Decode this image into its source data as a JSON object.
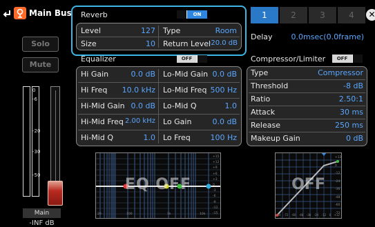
{
  "header": {
    "title": "Main Bus"
  },
  "left": {
    "solo_label": "Solo",
    "mute_label": "Mute",
    "meter_ticks": [
      "0",
      "-6",
      "-20",
      "-30",
      "-50"
    ],
    "channel_label": "Main",
    "level_readout": "-INF dB"
  },
  "reverb": {
    "title": "Reverb",
    "toggle": "ON",
    "level_label": "Level",
    "level_value": "127",
    "type_label": "Type",
    "type_value": "Room",
    "size_label": "Size",
    "size_value": "10",
    "return_label": "Return Level",
    "return_value": "-20.0 dB"
  },
  "tabs": [
    "1",
    "2",
    "3",
    "4"
  ],
  "delay": {
    "label": "Delay",
    "value": "0.0msec(0.0frame)"
  },
  "equalizer": {
    "title": "Equalizer",
    "toggle": "OFF",
    "rows": [
      {
        "l_label": "Hi Gain",
        "l_value": "0.0 dB",
        "r_label": "Lo-Mid Gain",
        "r_value": "0.0 dB"
      },
      {
        "l_label": "Hi Freq",
        "l_value": "10.0 kHz",
        "r_label": "Lo-Mid Freq",
        "r_value": "500 Hz"
      },
      {
        "l_label": "Hi-Mid Gain",
        "l_value": "0.0 dB",
        "r_label": "Lo-Mid Q",
        "r_value": "1.0"
      },
      {
        "l_label": "Hi-Mid Freq",
        "l_value": "2.00 kHz",
        "r_label": "Lo Gain",
        "r_value": "0.0 dB"
      },
      {
        "l_label": "Hi-Mid Q",
        "l_value": "1.0",
        "r_label": "Lo Freq",
        "r_value": "100 Hz"
      }
    ],
    "graph_overlay": "EQ OFF",
    "graph_ticks_y": [
      "+15",
      "+12",
      "+9",
      "+6",
      "+3",
      "0",
      "-3",
      "-6",
      "-9",
      "-12",
      "-15"
    ],
    "graph_ticks_x": [
      "20",
      "100",
      "1k",
      "10k",
      "20k"
    ]
  },
  "compressor": {
    "title": "Compressor/Limiter",
    "toggle": "OFF",
    "rows": [
      {
        "label": "Type",
        "value": "Compressor"
      },
      {
        "label": "Threshold",
        "value": "-8 dB"
      },
      {
        "label": "Ratio",
        "value": "2.50:1"
      },
      {
        "label": "Attack",
        "value": "30 ms"
      },
      {
        "label": "Release",
        "value": "250 ms"
      },
      {
        "label": "Makeup Gain",
        "value": "0 dB"
      }
    ],
    "graph_overlay": "OFF",
    "graph_ticks_y": [
      "+12",
      "0",
      "-12",
      "-24",
      "-36",
      "-48",
      "-60",
      "-72"
    ],
    "graph_ticks_x": [
      "-84",
      "-72",
      "-60",
      "-48",
      "-36",
      "-24",
      "-12",
      "0",
      "+12"
    ]
  },
  "colors": {
    "accent_blue": "#5aa7ff",
    "selection_border": "#3fb6e8",
    "tab_active": "#2a78c8",
    "eq_node_red": "#e23a3a",
    "eq_node_yellow": "#d8d820",
    "eq_node_green": "#40c040",
    "eq_node_cyan": "#30b0e0"
  }
}
